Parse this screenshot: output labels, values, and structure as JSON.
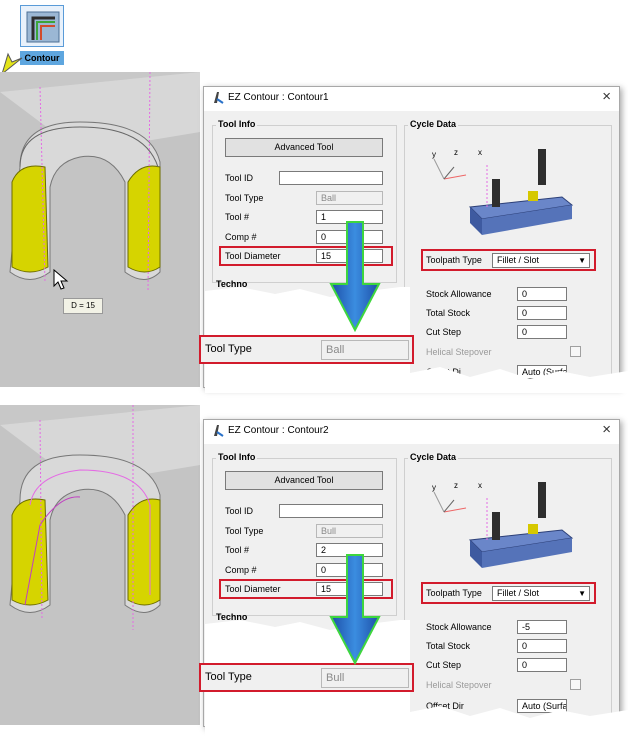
{
  "toolbar": {
    "contour_label": "Contour",
    "icon": "contour-icon"
  },
  "colors": {
    "highlight_red": "#d21b2c",
    "arrow_blue": "#1f5fbf",
    "arrow_green": "#3ed63e",
    "part_yellow": "#d8d800"
  },
  "top": {
    "viewport": {
      "dimension_tooltip": "D = 15"
    },
    "dialog": {
      "title": "EZ Contour : Contour1",
      "tool_info": {
        "group_title": "Tool Info",
        "advanced_tool_button": "Advanced Tool",
        "tool_id_label": "Tool ID",
        "tool_id_value": "",
        "tool_type_label": "Tool Type",
        "tool_type_value": "Ball",
        "tool_num_label": "Tool #",
        "tool_num_value": "1",
        "comp_num_label": "Comp #",
        "comp_num_value": "0",
        "tool_diameter_label": "Tool Diameter",
        "tool_diameter_value": "15",
        "technology_partial": "Techno"
      },
      "cycle_data": {
        "group_title": "Cycle Data",
        "toolpath_type_label": "Toolpath Type",
        "toolpath_type_value": "Fillet / Slot",
        "stock_allowance_label": "Stock Allowance",
        "stock_allowance_value": "0",
        "total_stock_label": "Total Stock",
        "total_stock_value": "0",
        "cut_step_label": "Cut Step",
        "cut_step_value": "0",
        "helical_stepover_label": "Helical Stepover",
        "offset_dir_label": "Offset Di",
        "offset_dir_value": "Auto (Surfac"
      },
      "callout": {
        "tool_type_label": "Tool Type",
        "tool_type_value": "Ball"
      }
    }
  },
  "bottom": {
    "dialog": {
      "title": "EZ Contour : Contour2",
      "tool_info": {
        "group_title": "Tool Info",
        "advanced_tool_button": "Advanced Tool",
        "tool_id_label": "Tool ID",
        "tool_id_value": "",
        "tool_type_label": "Tool Type",
        "tool_type_value": "Bull",
        "tool_num_label": "Tool #",
        "tool_num_value": "2",
        "comp_num_label": "Comp #",
        "comp_num_value": "0",
        "tool_diameter_label": "Tool Diameter",
        "tool_diameter_value": "15",
        "technology_partial": "Techno"
      },
      "cycle_data": {
        "group_title": "Cycle Data",
        "toolpath_type_label": "Toolpath Type",
        "toolpath_type_value": "Fillet / Slot",
        "stock_allowance_label": "Stock Allowance",
        "stock_allowance_value": "-5",
        "total_stock_label": "Total Stock",
        "total_stock_value": "0",
        "cut_step_label": "Cut Step",
        "cut_step_value": "0",
        "helical_stepover_label": "Helical Stepover",
        "offset_dir_label": "Offset Dir",
        "offset_dir_value": "Auto (Surfac"
      },
      "callout": {
        "tool_type_label": "Tool Type",
        "tool_type_value": "Bull"
      }
    }
  }
}
